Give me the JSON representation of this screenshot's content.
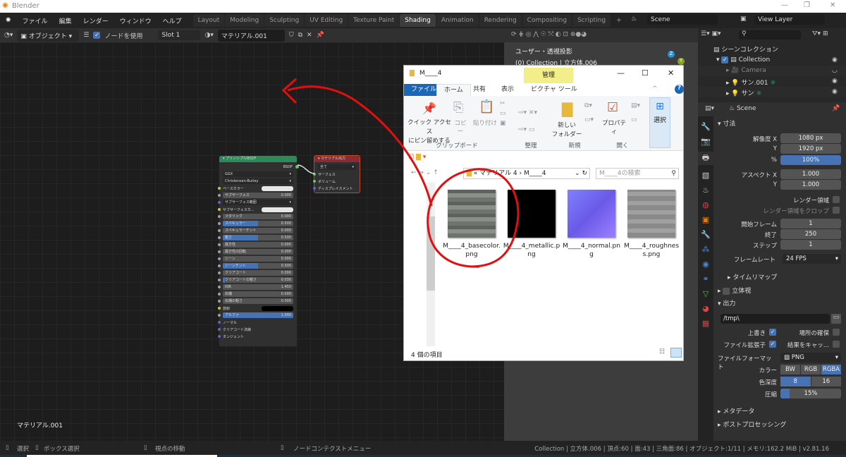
{
  "window": {
    "title": "Blender",
    "minimize": "—",
    "maximize": "❐",
    "close": "✕"
  },
  "menubar": {
    "items": [
      "ファイル",
      "編集",
      "レンダー",
      "ウィンドウ",
      "ヘルプ"
    ],
    "tabs": [
      "Layout",
      "Modeling",
      "Sculpting",
      "UV Editing",
      "Texture Paint",
      "Shading",
      "Animation",
      "Rendering",
      "Compositing",
      "Scripting",
      "+"
    ],
    "active_tab": "Shading",
    "scene": "Scene",
    "view_layer": "View Layer"
  },
  "node_header": {
    "mode": "オブジェクト",
    "use_nodes_label": "ノードを使用",
    "use_nodes": true,
    "slot": "Slot 1",
    "material": "マテリアル.001"
  },
  "node_editor": {
    "material_label": "マテリアル.001",
    "bsdf_node": {
      "title": "プリンシプルBSDF",
      "output": "BSDF",
      "distribution": "GGX",
      "subsurface_method": "Christensen-Burley",
      "rows": [
        {
          "label": "ベースカラー",
          "type": "color",
          "color": "#e6e6e6",
          "socket": "#c7c729"
        },
        {
          "label": "サブサーフェス",
          "value": "0.000",
          "fill": 0
        },
        {
          "label": "サブサーフェス範囲",
          "type": "dropdown",
          "socket": "#6363c7"
        },
        {
          "label": "サブサーフェスカ...",
          "type": "color",
          "color": "#e6e6e6",
          "socket": "#c7c729"
        },
        {
          "label": "メタリック",
          "value": "0.000",
          "fill": 0
        },
        {
          "label": "スペキュラー",
          "value": "0.500",
          "fill": 0.5
        },
        {
          "label": "スペキュラーチント",
          "value": "0.000",
          "fill": 0
        },
        {
          "label": "粗さ",
          "value": "0.500",
          "fill": 0.5
        },
        {
          "label": "異方性",
          "value": "0.000",
          "fill": 0
        },
        {
          "label": "異方性の回転",
          "value": "0.000",
          "fill": 0
        },
        {
          "label": "シーン",
          "value": "0.000",
          "fill": 0
        },
        {
          "label": "シーンチント",
          "value": "0.500",
          "fill": 0.5
        },
        {
          "label": "クリアコート",
          "value": "0.000",
          "fill": 0
        },
        {
          "label": "クリアコートの粗さ",
          "value": "0.030",
          "fill": 0.03
        },
        {
          "label": "IOR",
          "value": "1.450",
          "fill": 0
        },
        {
          "label": "伝播",
          "value": "0.000",
          "fill": 0
        },
        {
          "label": "伝播の粗さ",
          "value": "0.000",
          "fill": 0
        },
        {
          "label": "放射",
          "type": "color",
          "color": "#000000",
          "socket": "#c7c729"
        },
        {
          "label": "アルファ",
          "value": "1.000",
          "fill": 1
        },
        {
          "label": "ノーマル",
          "type": "socket",
          "socket": "#6363c7"
        },
        {
          "label": "クリアコート法線",
          "type": "socket",
          "socket": "#6363c7"
        },
        {
          "label": "タンジェント",
          "type": "socket",
          "socket": "#6363c7"
        }
      ]
    },
    "output_node": {
      "title": "マテリアル出力",
      "target": "全て",
      "inputs": [
        "サーフェス",
        "ボリューム",
        "ディスプレイスメント"
      ]
    }
  },
  "viewport": {
    "view_label": "ユーザー・透視投影",
    "collection_label": "(0) Collection | 立方体.006"
  },
  "explorer": {
    "title": "M____4",
    "manage_tab": "管理",
    "ribbon_tabs": [
      "ファイル",
      "ホーム",
      "共有",
      "表示",
      "ピクチャ ツール"
    ],
    "ribbon": {
      "pin": "クイック アクセス\nにピン留めする",
      "copy": "コピー",
      "paste": "貼り付け",
      "new_folder": "新しい\nフォルダー",
      "properties": "プロパティ",
      "select": "選択",
      "groups": [
        "クリップボード",
        "整理",
        "新規",
        "開く"
      ]
    },
    "path": [
      "マテリアル 4",
      "M____4"
    ],
    "search_placeholder": "M____4の検索",
    "files": [
      {
        "name": "M____4_basecolor.png",
        "kind": "stone"
      },
      {
        "name": "M____4_metallic.png",
        "kind": "black"
      },
      {
        "name": "M____4_normal.png",
        "kind": "normal"
      },
      {
        "name": "M____4_roughness.png",
        "kind": "gray"
      }
    ],
    "item_count": "4 個の項目"
  },
  "outliner": {
    "root": "シーンコレクション",
    "items": [
      {
        "label": "Collection",
        "visible": true
      },
      {
        "label": "Camera",
        "visible": false
      },
      {
        "label": "サン.001",
        "visible": true
      },
      {
        "label": "サン",
        "visible": true
      }
    ]
  },
  "properties": {
    "scene": "Scene",
    "dimensions": {
      "title": "寸法",
      "res_x_label": "解像度 X",
      "res_x": "1080 px",
      "res_y_label": "Y",
      "res_y": "1920 px",
      "pct_label": "%",
      "pct": "100%",
      "aspect_x_label": "アスペクト X",
      "aspect_x": "1.000",
      "aspect_y_label": "Y",
      "aspect_y": "1.000",
      "render_region": "レンダー領域",
      "crop": "レンダー領域をクロップ",
      "frame_start_label": "開始フレーム",
      "frame_start": "1",
      "frame_end_label": "終了",
      "frame_end": "250",
      "step_label": "ステップ",
      "step": "1",
      "fps_label": "フレームレート",
      "fps": "24 FPS",
      "time_remap": "タイムリマップ"
    },
    "stereo": "立体視",
    "output": {
      "title": "出力",
      "path": "/tmp\\",
      "overwrite": "上書き",
      "overwrite_on": true,
      "placeholders": "場所の確保",
      "placeholders_on": false,
      "extension": "ファイル拡張子",
      "extension_on": true,
      "cache": "結果をキャッ...",
      "cache_on": false,
      "format_label": "ファイルフォーマット",
      "format": "PNG",
      "color_label": "カラー",
      "color_modes": [
        "BW",
        "RGB",
        "RGBA"
      ],
      "color_active": "RGBA",
      "depth_label": "色深度",
      "depths": [
        "8",
        "16"
      ],
      "depth_active": "8",
      "compression_label": "圧縮",
      "compression": "15%",
      "compression_value": 0.15
    },
    "metadata": "メタデータ",
    "post": "ポストプロセッシング"
  },
  "statusbar": {
    "select": "選択",
    "box_select": "ボックス選択",
    "pan": "視点の移動",
    "context_menu": "ノードコンテクストメニュー",
    "stats": "Collection | 立方体.006 | 頂点:60 | 面:43 | 三角面:86 | オブジェクト:1/11 | メモリ:162.2 MiB | v2.81.16"
  },
  "annotation_color": "#e01010",
  "accent": "#4772b3"
}
